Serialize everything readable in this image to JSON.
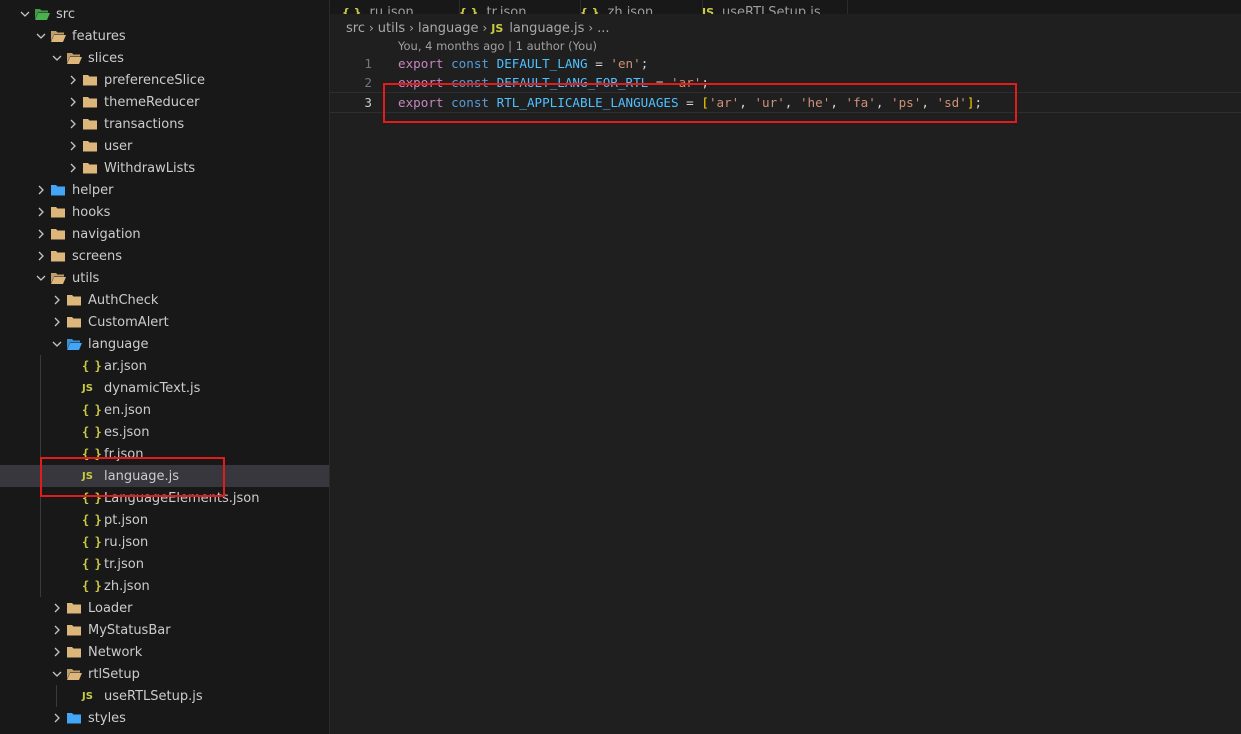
{
  "explorer": {
    "items": [
      {
        "label": "src",
        "indent": 0,
        "type": "folder",
        "open": true,
        "color": "#4caf50"
      },
      {
        "label": "features",
        "indent": 1,
        "type": "folder",
        "open": true,
        "color": "#dcb67a"
      },
      {
        "label": "slices",
        "indent": 2,
        "type": "folder",
        "open": true,
        "color": "#dcb67a"
      },
      {
        "label": "preferenceSlice",
        "indent": 3,
        "type": "folder",
        "open": false,
        "color": "#dcb67a"
      },
      {
        "label": "themeReducer",
        "indent": 3,
        "type": "folder",
        "open": false,
        "color": "#dcb67a"
      },
      {
        "label": "transactions",
        "indent": 3,
        "type": "folder",
        "open": false,
        "color": "#dcb67a"
      },
      {
        "label": "user",
        "indent": 3,
        "type": "folder",
        "open": false,
        "color": "#dcb67a"
      },
      {
        "label": "WithdrawLists",
        "indent": 3,
        "type": "folder",
        "open": false,
        "color": "#dcb67a"
      },
      {
        "label": "helper",
        "indent": 1,
        "type": "folder",
        "open": false,
        "color": "#42a5f5"
      },
      {
        "label": "hooks",
        "indent": 1,
        "type": "folder",
        "open": false,
        "color": "#dcb67a"
      },
      {
        "label": "navigation",
        "indent": 1,
        "type": "folder",
        "open": false,
        "color": "#dcb67a"
      },
      {
        "label": "screens",
        "indent": 1,
        "type": "folder",
        "open": false,
        "color": "#dcb67a"
      },
      {
        "label": "utils",
        "indent": 1,
        "type": "folder",
        "open": true,
        "color": "#dcb67a"
      },
      {
        "label": "AuthCheck",
        "indent": 2,
        "type": "folder",
        "open": false,
        "color": "#dcb67a"
      },
      {
        "label": "CustomAlert",
        "indent": 2,
        "type": "folder",
        "open": false,
        "color": "#dcb67a"
      },
      {
        "label": "language",
        "indent": 2,
        "type": "folder",
        "open": true,
        "color": "#42a5f5"
      },
      {
        "label": "ar.json",
        "indent": 3,
        "type": "json"
      },
      {
        "label": "dynamicText.js",
        "indent": 3,
        "type": "js"
      },
      {
        "label": "en.json",
        "indent": 3,
        "type": "json"
      },
      {
        "label": "es.json",
        "indent": 3,
        "type": "json"
      },
      {
        "label": "fr.json",
        "indent": 3,
        "type": "json"
      },
      {
        "label": "language.js",
        "indent": 3,
        "type": "js",
        "selected": true
      },
      {
        "label": "LanguageElements.json",
        "indent": 3,
        "type": "json"
      },
      {
        "label": "pt.json",
        "indent": 3,
        "type": "json"
      },
      {
        "label": "ru.json",
        "indent": 3,
        "type": "json"
      },
      {
        "label": "tr.json",
        "indent": 3,
        "type": "json"
      },
      {
        "label": "zh.json",
        "indent": 3,
        "type": "json"
      },
      {
        "label": "Loader",
        "indent": 2,
        "type": "folder",
        "open": false,
        "color": "#dcb67a"
      },
      {
        "label": "MyStatusBar",
        "indent": 2,
        "type": "folder",
        "open": false,
        "color": "#dcb67a"
      },
      {
        "label": "Network",
        "indent": 2,
        "type": "folder",
        "open": false,
        "color": "#dcb67a"
      },
      {
        "label": "rtlSetup",
        "indent": 2,
        "type": "folder",
        "open": true,
        "color": "#dcb67a"
      },
      {
        "label": "useRTLSetup.js",
        "indent": 3,
        "type": "js"
      },
      {
        "label": "styles",
        "indent": 2,
        "type": "folder",
        "open": false,
        "color": "#42a5f5"
      }
    ],
    "js_badge": "JS",
    "json_badge": "{ }"
  },
  "tabs": [
    {
      "label": "ru.json",
      "icon": "{ }"
    },
    {
      "label": "tr.json",
      "icon": "{ }"
    },
    {
      "label": "zh.json",
      "icon": "{ }"
    },
    {
      "label": "useRTLSetup.js",
      "icon": "JS"
    }
  ],
  "breadcrumb": {
    "parts": [
      "src",
      "utils",
      "language"
    ],
    "file_badge": "JS",
    "file": "language.js",
    "ellipsis": "..."
  },
  "blame": "You, 4 months ago | 1 author (You)",
  "code": {
    "lines": [
      {
        "num": "1",
        "tokens": [
          [
            "kw",
            "export"
          ],
          [
            "op",
            " "
          ],
          [
            "st",
            "const"
          ],
          [
            "op",
            " "
          ],
          [
            "cn",
            "DEFAULT_LANG"
          ],
          [
            "op",
            " = "
          ],
          [
            "str",
            "'en'"
          ],
          [
            "op",
            ";"
          ]
        ]
      },
      {
        "num": "2",
        "tokens": [
          [
            "kw",
            "export"
          ],
          [
            "op",
            " "
          ],
          [
            "st",
            "const"
          ],
          [
            "op",
            " "
          ],
          [
            "cn",
            "DEFAULT_LANG_FOR_RTL"
          ],
          [
            "op",
            " = "
          ],
          [
            "str",
            "'ar'"
          ],
          [
            "op",
            ";"
          ]
        ]
      },
      {
        "num": "3",
        "active": true,
        "tokens": [
          [
            "kw",
            "export"
          ],
          [
            "op",
            " "
          ],
          [
            "st",
            "const"
          ],
          [
            "op",
            " "
          ],
          [
            "cn",
            "RTL_APPLICABLE_LANGUAGES"
          ],
          [
            "op",
            " = "
          ],
          [
            "br",
            "["
          ],
          [
            "str",
            "'ar'"
          ],
          [
            "op",
            ", "
          ],
          [
            "str",
            "'ur'"
          ],
          [
            "op",
            ", "
          ],
          [
            "str",
            "'he'"
          ],
          [
            "op",
            ", "
          ],
          [
            "str",
            "'fa'"
          ],
          [
            "op",
            ", "
          ],
          [
            "str",
            "'ps'"
          ],
          [
            "op",
            ", "
          ],
          [
            "str",
            "'sd'"
          ],
          [
            "br",
            "]"
          ],
          [
            "op",
            ";"
          ]
        ]
      }
    ]
  },
  "colors": {
    "highlight_box": "#e21b1b",
    "selected_row": "#37373d"
  }
}
